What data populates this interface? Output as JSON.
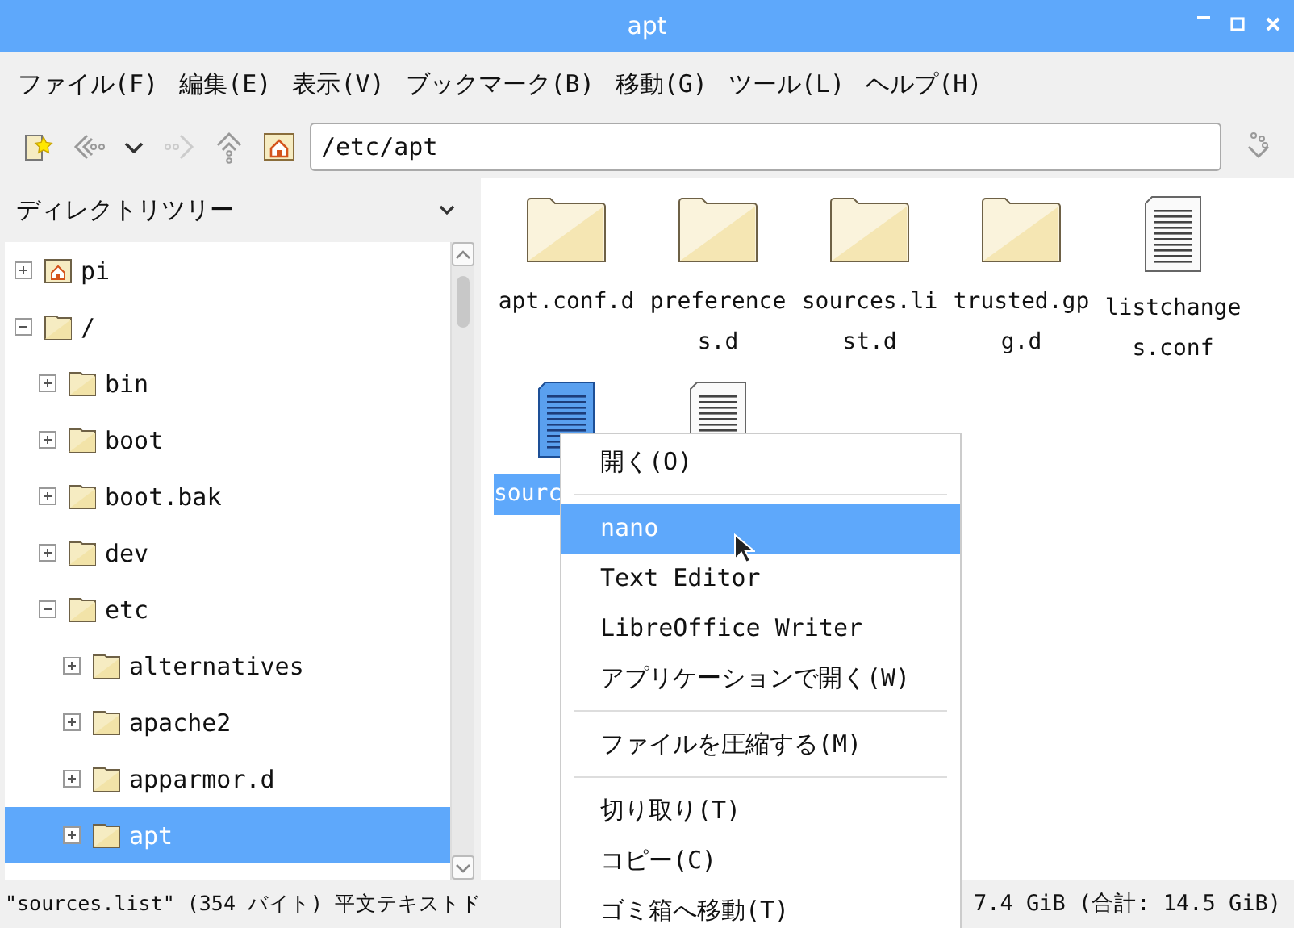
{
  "window": {
    "title": "apt"
  },
  "menu_bar": [
    "ファイル(F)",
    "編集(E)",
    "表示(V)",
    "ブックマーク(B)",
    "移動(G)",
    "ツール(L)",
    "ヘルプ(H)"
  ],
  "location": {
    "value": "/etc/apt"
  },
  "sidebar": {
    "title": "ディレクトリツリー",
    "tree": [
      {
        "label": "pi",
        "kind": "home",
        "expanded": false,
        "selected": false
      },
      {
        "label": "/",
        "kind": "folder",
        "expanded": true,
        "selected": false,
        "children": [
          {
            "label": "bin",
            "kind": "folder",
            "expanded": false,
            "selected": false
          },
          {
            "label": "boot",
            "kind": "folder",
            "expanded": false,
            "selected": false
          },
          {
            "label": "boot.bak",
            "kind": "folder",
            "expanded": false,
            "selected": false
          },
          {
            "label": "dev",
            "kind": "folder",
            "expanded": false,
            "selected": false
          },
          {
            "label": "etc",
            "kind": "folder",
            "expanded": true,
            "selected": false,
            "children": [
              {
                "label": "alternatives",
                "kind": "folder",
                "expanded": false,
                "selected": false
              },
              {
                "label": "apache2",
                "kind": "folder",
                "expanded": false,
                "selected": false
              },
              {
                "label": "apparmor.d",
                "kind": "folder",
                "expanded": false,
                "selected": false
              },
              {
                "label": "apt",
                "kind": "folder",
                "expanded": false,
                "selected": true
              }
            ]
          }
        ]
      }
    ]
  },
  "files": [
    {
      "label": "apt.conf.d",
      "kind": "folder",
      "selected": false
    },
    {
      "label": "preferences.d",
      "kind": "folder",
      "selected": false
    },
    {
      "label": "sources.list.d",
      "kind": "folder",
      "selected": false
    },
    {
      "label": "trusted.gpg.d",
      "kind": "folder",
      "selected": false
    },
    {
      "label": "listchanges.conf",
      "kind": "file",
      "selected": false
    },
    {
      "label": "sourc",
      "kind": "file",
      "selected": true
    },
    {
      "kind": "file",
      "selected": false
    }
  ],
  "context_menu": [
    {
      "kind": "item",
      "label": "開く(O)",
      "selected": false
    },
    {
      "kind": "separator"
    },
    {
      "kind": "item",
      "label": "nano",
      "selected": true
    },
    {
      "kind": "item",
      "label": "Text Editor",
      "selected": false
    },
    {
      "kind": "item",
      "label": "LibreOffice Writer",
      "selected": false
    },
    {
      "kind": "item",
      "label": "アプリケーションで開く(W)",
      "selected": false
    },
    {
      "kind": "separator"
    },
    {
      "kind": "item",
      "label": "ファイルを圧縮する(M)",
      "selected": false
    },
    {
      "kind": "separator"
    },
    {
      "kind": "item",
      "label": "切り取り(T)",
      "selected": false
    },
    {
      "kind": "item",
      "label": "コピー(C)",
      "selected": false
    },
    {
      "kind": "item",
      "label": "ゴミ箱へ移動(T)",
      "selected": false
    }
  ],
  "status_bar": {
    "selection": "\"sources.list\" (354 バイト) 平文テキストド",
    "free_space": "7.4 GiB (合計: 14.5 GiB)"
  }
}
